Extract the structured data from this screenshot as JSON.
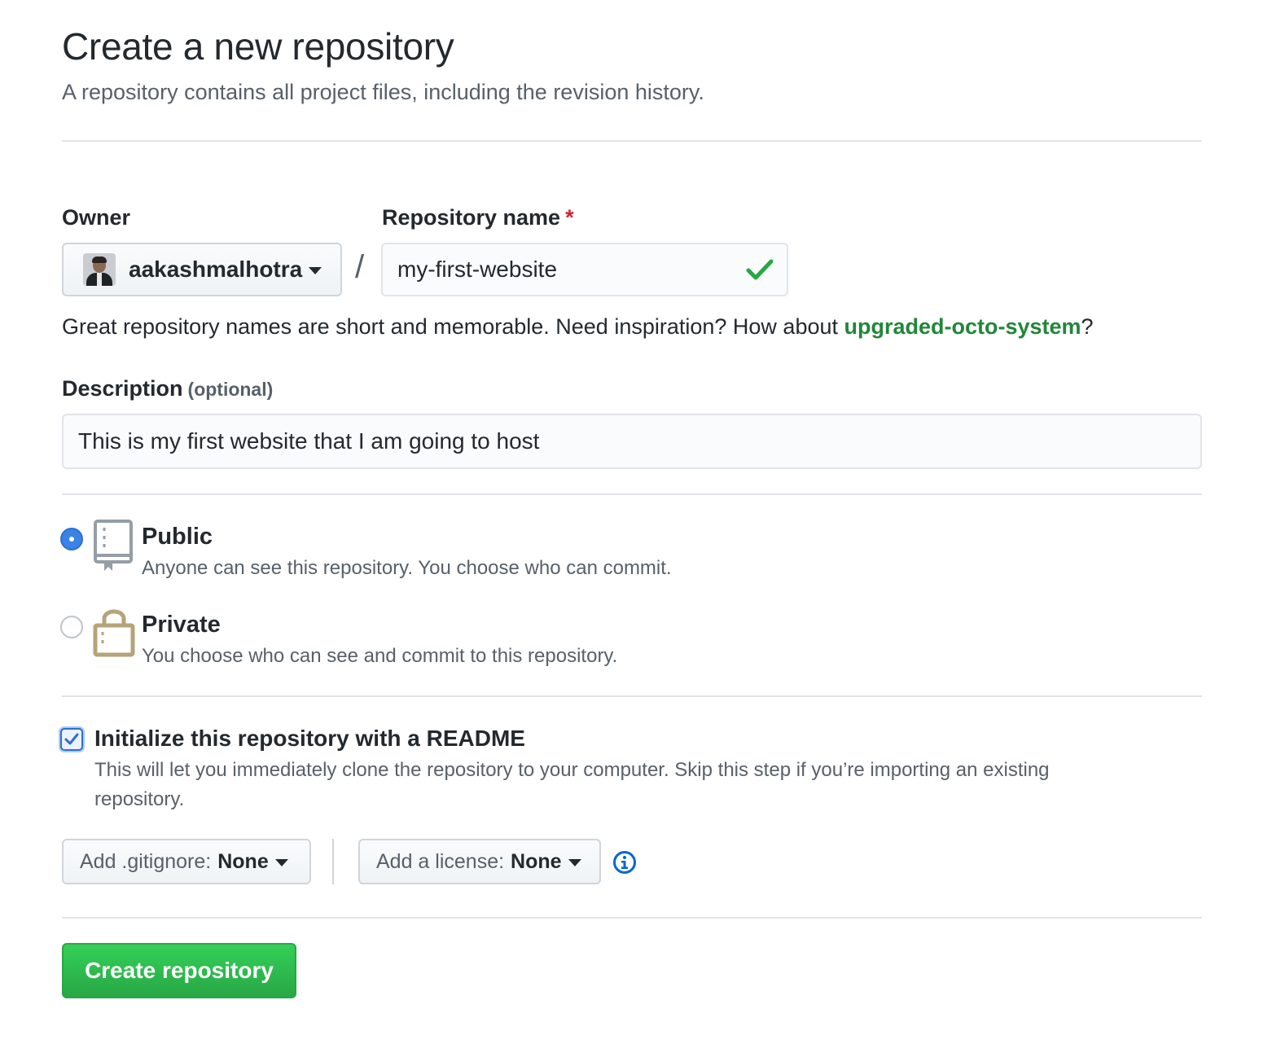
{
  "header": {
    "title": "Create a new repository",
    "subtitle": "A repository contains all project files, including the revision history."
  },
  "owner": {
    "label": "Owner",
    "name": "aakashmalhotra"
  },
  "separator": "/",
  "repo_name": {
    "label": "Repository name",
    "required_mark": "*",
    "value": "my-first-website",
    "valid": true
  },
  "hint": {
    "text": "Great repository names are short and memorable. Need inspiration? How about ",
    "suggestion": "upgraded-octo-system",
    "suffix": "?"
  },
  "description": {
    "label": "Description",
    "optional_note": "(optional)",
    "value": "This is my first website that I am going to host"
  },
  "visibility": {
    "selected": "public",
    "public": {
      "title": "Public",
      "desc": "Anyone can see this repository. You choose who can commit."
    },
    "private": {
      "title": "Private",
      "desc": "You choose who can see and commit to this repository."
    }
  },
  "init_readme": {
    "checked": true,
    "title": "Initialize this repository with a README",
    "desc_line1": "This will let you immediately clone the repository to your computer. Skip this step if you’re importing an existing",
    "desc_line2": "repository."
  },
  "gitignore": {
    "label": "Add .gitignore:",
    "value": "None"
  },
  "license": {
    "label": "Add a license:",
    "value": "None"
  },
  "icons": {
    "valid": "check-icon",
    "public": "repo-icon",
    "private": "lock-icon",
    "info": "info-icon",
    "caret": "triangle-down-icon"
  },
  "colors": {
    "suggestion": "#22863a",
    "required": "#cb2431",
    "valid_check": "#28a745",
    "radio_selected": "#3b82e6",
    "primary_button": "#2ea44f",
    "info": "#0366d6",
    "lock": "#b5a47a"
  },
  "submit": {
    "label": "Create repository"
  }
}
